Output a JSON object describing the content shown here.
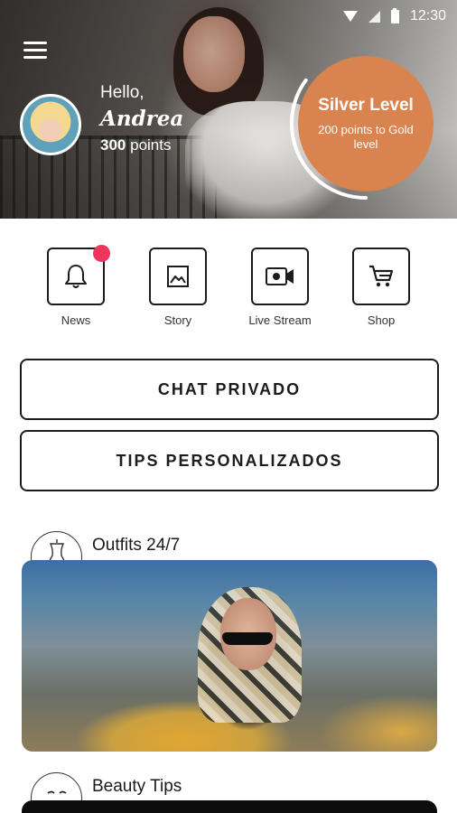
{
  "status_bar": {
    "time": "12:30"
  },
  "header": {
    "greeting": "Hello,",
    "user_name": "Andrea",
    "points_value": "300",
    "points_suffix": "points"
  },
  "level": {
    "title": "Silver Level",
    "subtitle": "200 points to Gold level",
    "progress_fraction": 0.35,
    "color": "#d9834f"
  },
  "actions": [
    {
      "label": "News",
      "icon": "bell-icon",
      "has_notification": true
    },
    {
      "label": "Story",
      "icon": "image-icon"
    },
    {
      "label": "Live Stream",
      "icon": "video-camera-icon"
    },
    {
      "label": "Shop",
      "icon": "shopping-cart-icon"
    }
  ],
  "buttons": {
    "chat": "CHAT PRIVADO",
    "tips": "TIPS PERSONALIZADOS"
  },
  "sections": [
    {
      "title": "Outfits 24/7",
      "icon": "dress-form-icon"
    },
    {
      "title": "Beauty Tips",
      "icon": "face-makeup-icon"
    }
  ],
  "colors": {
    "accent": "#d9834f",
    "notification": "#f0355b",
    "outline": "#1c1c1c"
  }
}
